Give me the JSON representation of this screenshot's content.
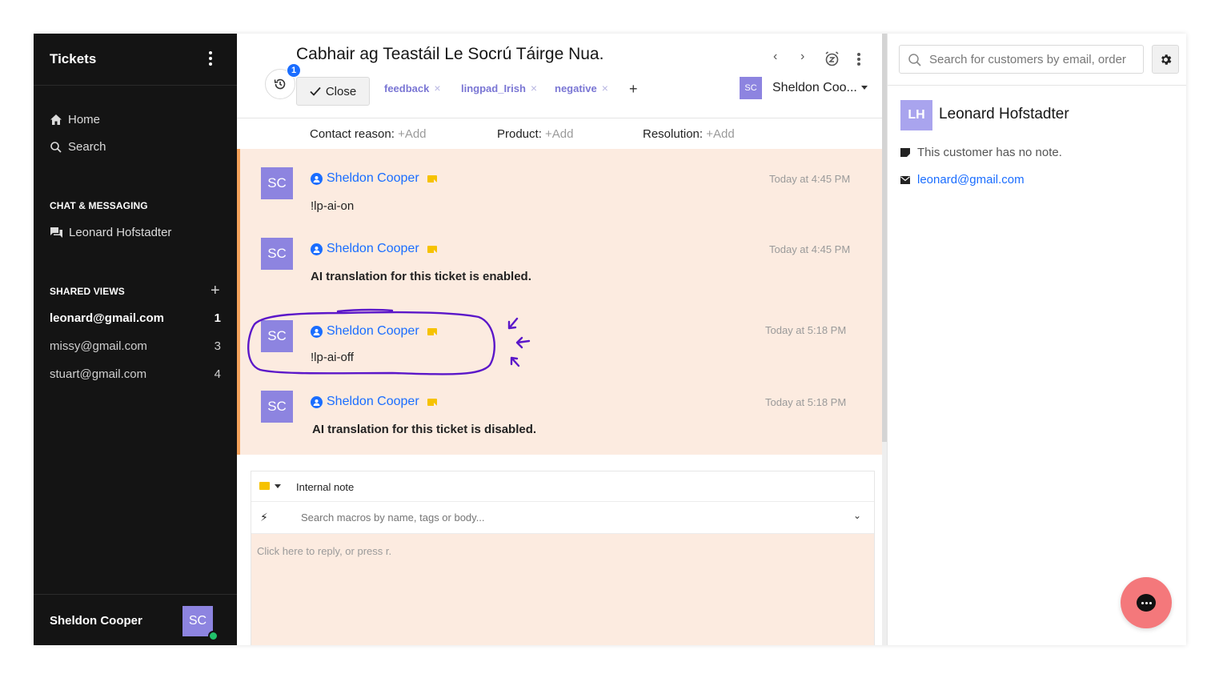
{
  "sidebar": {
    "title": "Tickets",
    "nav": [
      {
        "label": "Home",
        "icon": "home-icon"
      },
      {
        "label": "Search",
        "icon": "search-icon"
      }
    ],
    "chat_section": "CHAT & MESSAGING",
    "chat_items": [
      {
        "label": "Leonard Hofstadter",
        "icon": "chat-icon"
      }
    ],
    "shared_section": "SHARED VIEWS",
    "views": [
      {
        "label": "leonard@gmail.com",
        "count": "1",
        "active": true
      },
      {
        "label": "missy@gmail.com",
        "count": "3",
        "active": false
      },
      {
        "label": "stuart@gmail.com",
        "count": "4",
        "active": false
      }
    ],
    "user": {
      "name": "Sheldon Cooper",
      "initials": "SC",
      "status_color": "#21c16b"
    }
  },
  "ticket": {
    "title": "Cabhair ag Teastáil Le Socrú Táirge Nua.",
    "history_badge": "1",
    "close_label": "Close",
    "tags": [
      "feedback",
      "lingpad_Irish",
      "negative"
    ],
    "tag_add": "+",
    "assignee": {
      "initials": "SC",
      "name": "Sheldon Coo..."
    },
    "fields": [
      {
        "label": "Contact reason:",
        "value": "+Add"
      },
      {
        "label": "Product:",
        "value": "+Add"
      },
      {
        "label": "Resolution:",
        "value": "+Add"
      }
    ],
    "messages": [
      {
        "initials": "SC",
        "author": "Sheldon Cooper",
        "time": "Today at 4:45 PM",
        "body": "!lp-ai-on",
        "bold": false
      },
      {
        "initials": "SC",
        "author": "Sheldon Cooper",
        "time": "Today at 4:45 PM",
        "body": "AI translation for this ticket is enabled.",
        "bold": true
      },
      {
        "initials": "SC",
        "author": "Sheldon Cooper",
        "time": "Today at 5:18 PM",
        "body": "!lp-ai-off",
        "bold": false
      },
      {
        "initials": "SC",
        "author": "Sheldon Cooper",
        "time": "Today at 5:18 PM",
        "body": "AI translation for this ticket is disabled.",
        "bold": true
      }
    ],
    "composer": {
      "mode": "Internal note",
      "macro_placeholder": "Search macros by name, tags or body...",
      "reply_placeholder": "Click here to reply, or press r."
    }
  },
  "customer_panel": {
    "search_placeholder": "Search for customers by email, order",
    "customer": {
      "initials": "LH",
      "name": "Leonard Hofstadter",
      "note": "This customer has no note.",
      "email": "leonard@gmail.com"
    }
  },
  "colors": {
    "accent": "#1a6dff",
    "avatar": "#8d84e0",
    "message_bg": "#fcebe0",
    "annotation": "#5b17c9",
    "chat_bubble": "#f4787b"
  }
}
